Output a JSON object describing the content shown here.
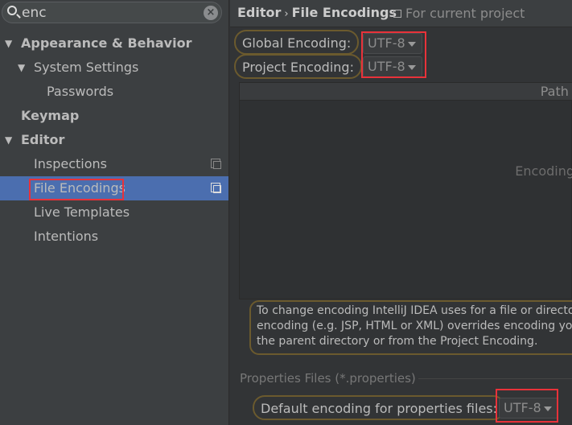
{
  "search": {
    "value": "enc"
  },
  "sidebar": {
    "items": [
      {
        "label": "Appearance & Behavior"
      },
      {
        "label": "System Settings"
      },
      {
        "label": "Passwords"
      },
      {
        "label": "Keymap"
      },
      {
        "label": "Editor"
      },
      {
        "label": "Inspections"
      },
      {
        "label": "File Encodings",
        "selected": true
      },
      {
        "label": "Live Templates"
      },
      {
        "label": "Intentions"
      }
    ]
  },
  "header": {
    "crumb1": "Editor",
    "sep": "›",
    "crumb2": "File Encodings",
    "scope": "For current project"
  },
  "main": {
    "global_label": "Global Encoding:",
    "global_value": "UTF-8",
    "project_label": "Project Encoding:",
    "project_value": "UTF-8",
    "table": {
      "col_path": "Path ▴",
      "col_encoding": "Encoding"
    },
    "note": [
      "To change encoding IntelliJ IDEA uses for a file or directory",
      "encoding (e.g. JSP, HTML or XML) overrides encoding you",
      "the parent directory or from the Project Encoding."
    ],
    "props_section": "Properties Files (*.properties)",
    "props_label": "Default encoding for properties files:",
    "props_value": "UTF-8"
  },
  "colors": {
    "selection": "#4b6eaf",
    "highlight_box": "#e8323a",
    "search_outline": "#6b5a2e"
  }
}
